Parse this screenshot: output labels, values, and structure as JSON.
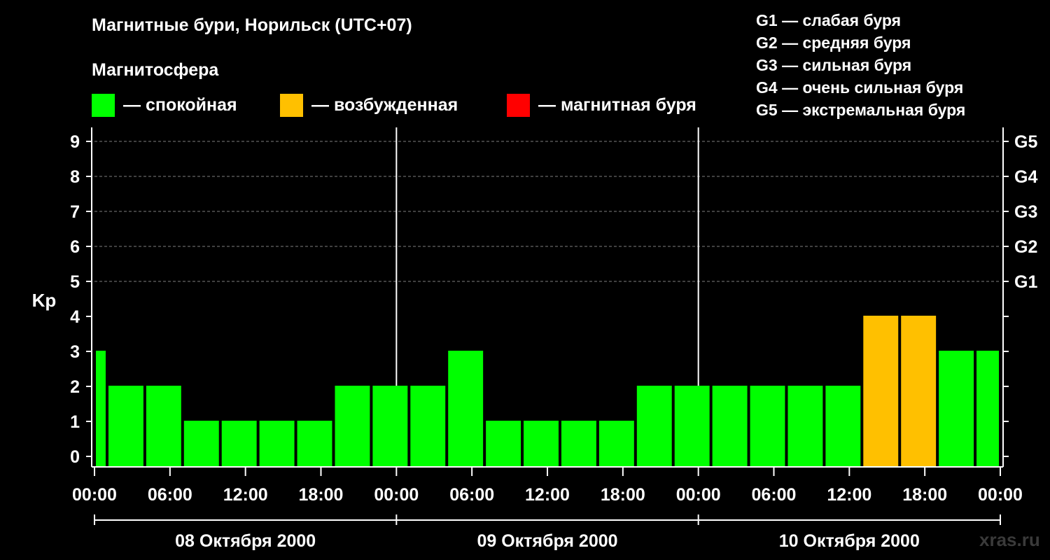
{
  "header": {
    "title": "Магнитные бури, Норильск (UTC+07)",
    "subtitle": "Магнитосфера"
  },
  "legend": [
    {
      "label": "— спокойная",
      "color": "#00ff00"
    },
    {
      "label": "— возбужденная",
      "color": "#ffc000"
    },
    {
      "label": "— магнитная буря",
      "color": "#ff0000"
    }
  ],
  "storm_levels": [
    "G1 — слабая буря",
    "G2 — средняя буря",
    "G3 — сильная буря",
    "G4 — очень сильная буря",
    "G5 — экстремальная буря"
  ],
  "watermark": "xras.ru",
  "chart_data": {
    "type": "bar",
    "title": "Магнитные бури, Норильск (UTC+07)",
    "ylabel": "Kp",
    "ylim": [
      0,
      9
    ],
    "y_ticks": [
      "0",
      "1",
      "2",
      "3",
      "4",
      "5",
      "6",
      "7",
      "8",
      "9"
    ],
    "right_axis_labels": [
      {
        "y": 5,
        "label": "G1"
      },
      {
        "y": 6,
        "label": "G2"
      },
      {
        "y": 7,
        "label": "G3"
      },
      {
        "y": 8,
        "label": "G4"
      },
      {
        "y": 9,
        "label": "G5"
      }
    ],
    "x_tick_labels": [
      "00:00",
      "06:00",
      "12:00",
      "18:00",
      "00:00",
      "06:00",
      "12:00",
      "18:00",
      "00:00",
      "06:00",
      "12:00",
      "18:00",
      "00:00"
    ],
    "day_labels": [
      "08 Октября 2000",
      "09 Октября 2000",
      "10 Октября 2000"
    ],
    "bars": [
      {
        "start": "2000-10-08 00:00",
        "end": "2000-10-08 01:00",
        "value": 3,
        "level": "quiet"
      },
      {
        "start": "2000-10-08 01:00",
        "end": "2000-10-08 04:00",
        "value": 2,
        "level": "quiet"
      },
      {
        "start": "2000-10-08 04:00",
        "end": "2000-10-08 07:00",
        "value": 2,
        "level": "quiet"
      },
      {
        "start": "2000-10-08 07:00",
        "end": "2000-10-08 10:00",
        "value": 1,
        "level": "quiet"
      },
      {
        "start": "2000-10-08 10:00",
        "end": "2000-10-08 13:00",
        "value": 1,
        "level": "quiet"
      },
      {
        "start": "2000-10-08 13:00",
        "end": "2000-10-08 16:00",
        "value": 1,
        "level": "quiet"
      },
      {
        "start": "2000-10-08 16:00",
        "end": "2000-10-08 19:00",
        "value": 1,
        "level": "quiet"
      },
      {
        "start": "2000-10-08 19:00",
        "end": "2000-10-08 22:00",
        "value": 2,
        "level": "quiet"
      },
      {
        "start": "2000-10-08 22:00",
        "end": "2000-10-09 01:00",
        "value": 2,
        "level": "quiet"
      },
      {
        "start": "2000-10-09 01:00",
        "end": "2000-10-09 04:00",
        "value": 2,
        "level": "quiet"
      },
      {
        "start": "2000-10-09 04:00",
        "end": "2000-10-09 07:00",
        "value": 3,
        "level": "quiet"
      },
      {
        "start": "2000-10-09 07:00",
        "end": "2000-10-09 10:00",
        "value": 1,
        "level": "quiet"
      },
      {
        "start": "2000-10-09 10:00",
        "end": "2000-10-09 13:00",
        "value": 1,
        "level": "quiet"
      },
      {
        "start": "2000-10-09 13:00",
        "end": "2000-10-09 16:00",
        "value": 1,
        "level": "quiet"
      },
      {
        "start": "2000-10-09 16:00",
        "end": "2000-10-09 19:00",
        "value": 1,
        "level": "quiet"
      },
      {
        "start": "2000-10-09 19:00",
        "end": "2000-10-09 22:00",
        "value": 2,
        "level": "quiet"
      },
      {
        "start": "2000-10-09 22:00",
        "end": "2000-10-10 01:00",
        "value": 2,
        "level": "quiet"
      },
      {
        "start": "2000-10-10 01:00",
        "end": "2000-10-10 04:00",
        "value": 2,
        "level": "quiet"
      },
      {
        "start": "2000-10-10 04:00",
        "end": "2000-10-10 07:00",
        "value": 2,
        "level": "quiet"
      },
      {
        "start": "2000-10-10 07:00",
        "end": "2000-10-10 10:00",
        "value": 2,
        "level": "quiet"
      },
      {
        "start": "2000-10-10 10:00",
        "end": "2000-10-10 13:00",
        "value": 2,
        "level": "quiet"
      },
      {
        "start": "2000-10-10 13:00",
        "end": "2000-10-10 16:00",
        "value": 4,
        "level": "active"
      },
      {
        "start": "2000-10-10 16:00",
        "end": "2000-10-10 19:00",
        "value": 4,
        "level": "active"
      },
      {
        "start": "2000-10-10 19:00",
        "end": "2000-10-10 22:00",
        "value": 3,
        "level": "quiet"
      },
      {
        "start": "2000-10-10 22:00",
        "end": "2000-10-11 00:00",
        "value": 3,
        "level": "quiet"
      }
    ],
    "level_colors": {
      "quiet": "#00ff00",
      "active": "#ffc000",
      "storm": "#ff0000"
    },
    "grid": "dashed horizontal lines at G1–G5 levels",
    "legend_position": "top"
  }
}
